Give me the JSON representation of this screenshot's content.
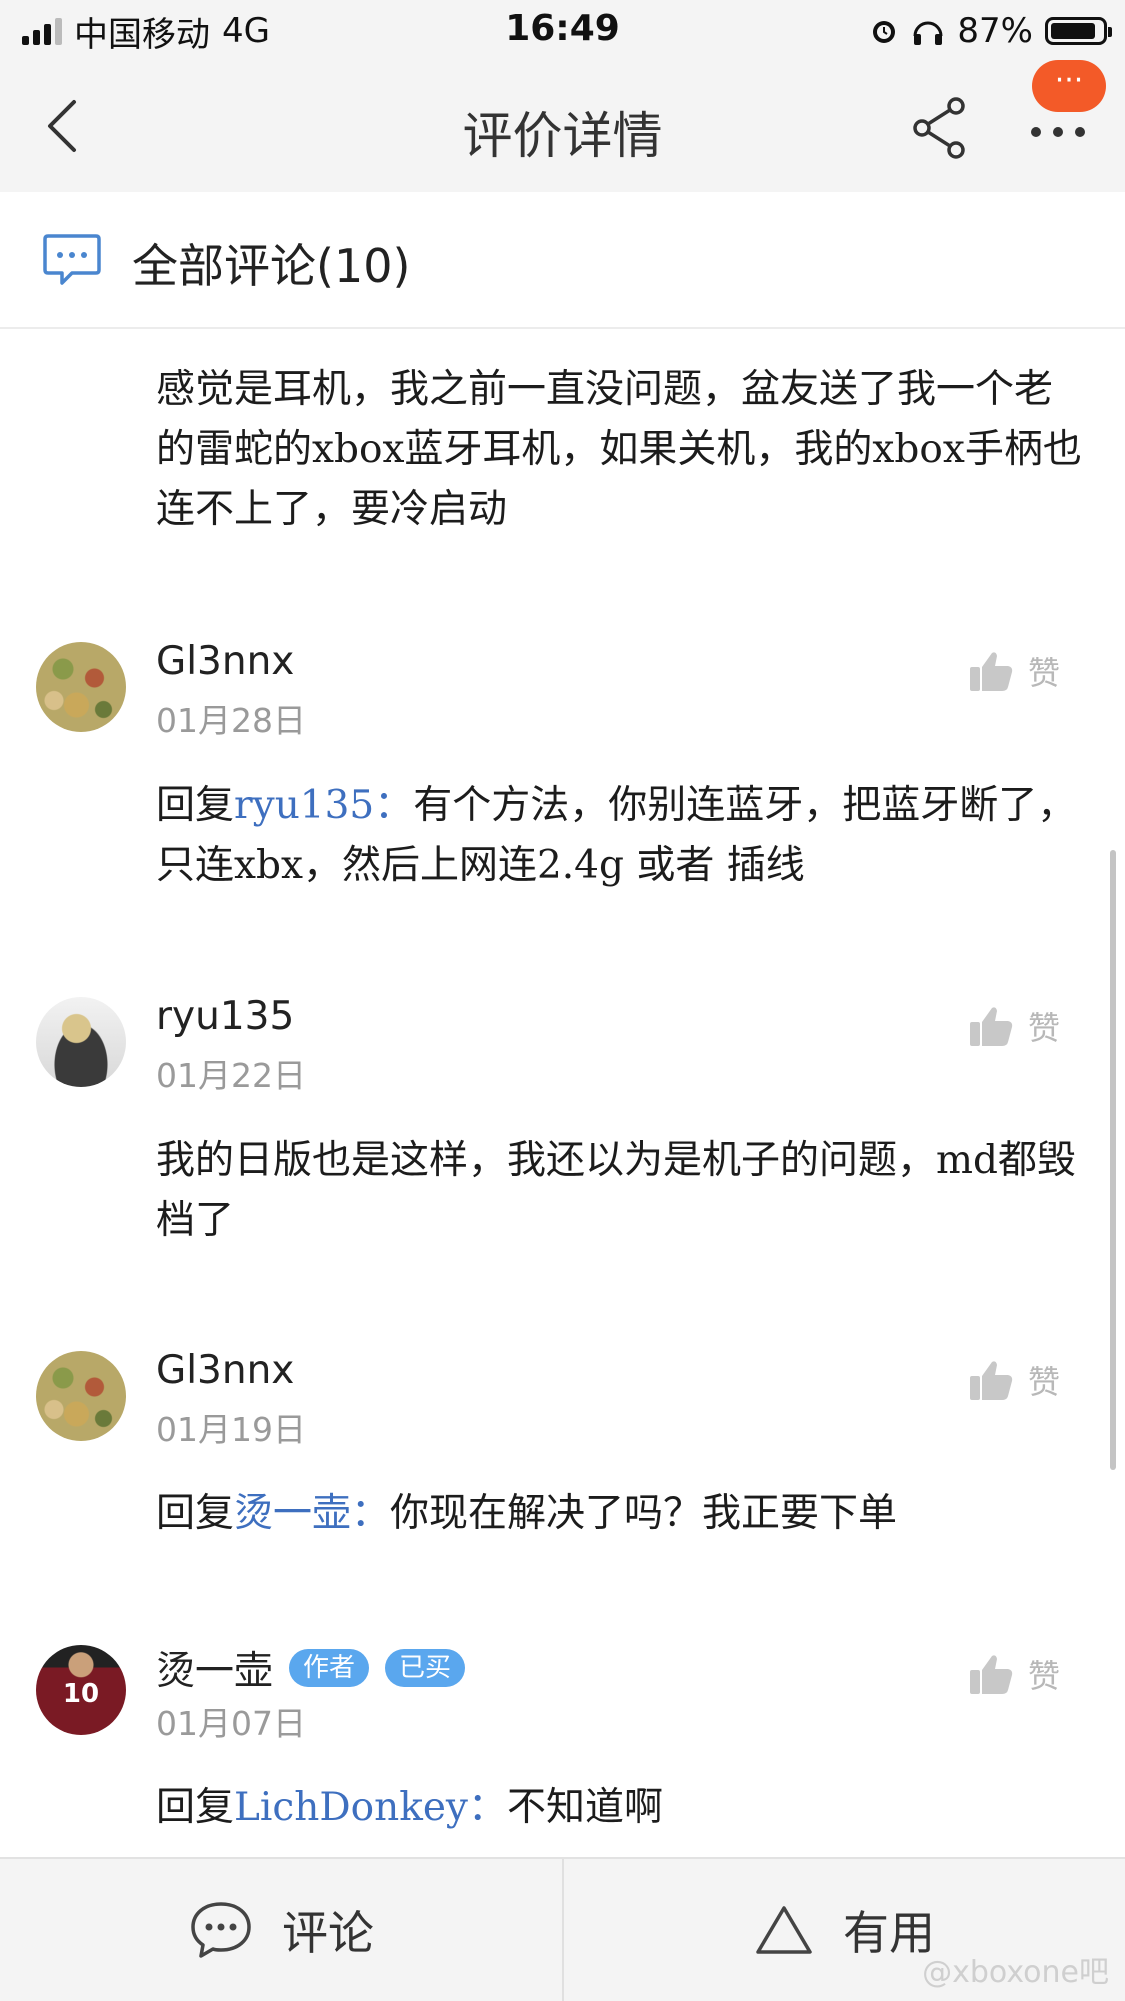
{
  "status_bar": {
    "carrier": "中国移动",
    "network": "4G",
    "time": "16:49",
    "battery": "87%",
    "battery_level": 0.87
  },
  "nav": {
    "title": "评价详情",
    "more_badge": "···"
  },
  "section": {
    "title": "全部评论(10)"
  },
  "first_reply": {
    "text": "感觉是耳机，我之前一直没问题，盆友送了我一个老的雷蛇的xbox蓝牙耳机，如果关机，我的xbox手柄也连不上了，要冷启动"
  },
  "comments": [
    {
      "user": "Gl3nnx",
      "date": "01月28日",
      "like": "赞",
      "prefix": "回复",
      "mention": "ryu135：",
      "text": "有个方法，你别连蓝牙，把蓝牙断了，只连xbx，然后上网连2.4g 或者 插线"
    },
    {
      "user": "ryu135",
      "date": "01月22日",
      "like": "赞",
      "text": "我的日版也是这样，我还以为是机子的问题，md都毁档了"
    },
    {
      "user": "Gl3nnx",
      "date": "01月19日",
      "like": "赞",
      "prefix": "回复",
      "mention": "烫一壶：",
      "text": "你现在解决了吗？我正要下单"
    },
    {
      "user": "烫一壶",
      "avatar_text": "10",
      "tags": [
        "作者",
        "已买"
      ],
      "date": "01月07日",
      "like": "赞",
      "prefix": "回复",
      "mention": "LichDonkey：",
      "text": "不知道啊"
    }
  ],
  "bottom": {
    "comment_label": "评论",
    "useful_label": "有用",
    "watermark": "@xboxone吧"
  },
  "colors": {
    "accent_badge": "#f35a28",
    "tag": "#5aa7ee",
    "mention": "#3e6fbf",
    "icon": "#4a86cf"
  }
}
